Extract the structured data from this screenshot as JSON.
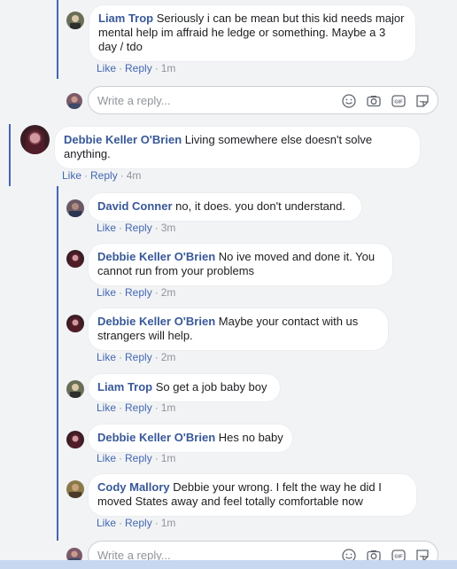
{
  "reply_placeholder": "Write a reply...",
  "actions": {
    "like": "Like",
    "reply": "Reply",
    "separator": "·"
  },
  "colors": {
    "accent": "#4267b2",
    "author": "#385898",
    "muted": "#90949c"
  },
  "comments": [
    {
      "author": "Liam Trop",
      "text": "Seriously i can be mean but this kid needs major mental help im affraid he ledge or something. Maybe a 3 day / tdo",
      "time": "1m"
    },
    {
      "author": "Debbie Keller O'Brien",
      "text": "Living somewhere else doesn't solve anything.",
      "time": "4m"
    },
    {
      "author": "David Conner",
      "text": "no, it does. you don't understand.",
      "time": "3m"
    },
    {
      "author": "Debbie Keller O'Brien",
      "text": "No ive moved and done it. You cannot run from your problems",
      "time": "2m"
    },
    {
      "author": "Debbie Keller O'Brien",
      "text": "Maybe your contact with us strangers will help.",
      "time": "2m"
    },
    {
      "author": "Liam Trop",
      "text": "So get a job baby boy",
      "time": "1m"
    },
    {
      "author": "Debbie Keller O'Brien",
      "text": "Hes no baby",
      "time": "1m"
    },
    {
      "author": "Cody Mallory",
      "text": "Debbie your wrong. I felt the way he did I moved States away and feel totally comfortable now",
      "time": "1m"
    }
  ],
  "reply_icons": [
    "emoji-icon",
    "camera-icon",
    "gif-icon",
    "sticker-icon"
  ]
}
